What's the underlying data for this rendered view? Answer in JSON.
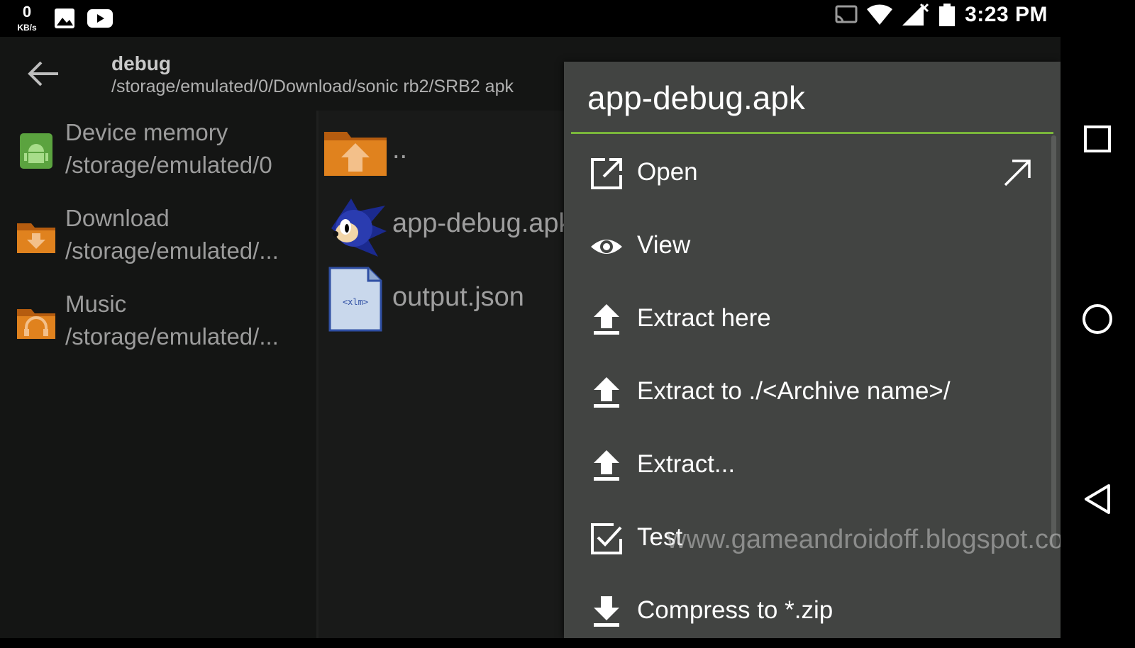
{
  "status_bar": {
    "speed_value": "0",
    "speed_unit": "KB/s",
    "time": "3:23 PM",
    "icons": [
      "network-speed-icon",
      "gallery-icon",
      "youtube-icon",
      "cast-icon",
      "wifi-icon",
      "signal-icon",
      "battery-icon"
    ]
  },
  "toolbar": {
    "title": "debug",
    "path": "/storage/emulated/0/Download/sonic rb2/SRB2 apk"
  },
  "sidebar": {
    "items": [
      {
        "name": "Device memory",
        "path": "/storage/emulated/0",
        "icon": "android-storage-icon"
      },
      {
        "name": "Download",
        "path": "/storage/emulated/...",
        "icon": "download-folder-icon"
      },
      {
        "name": "Music",
        "path": "/storage/emulated/...",
        "icon": "music-folder-icon"
      }
    ]
  },
  "files": [
    {
      "name": "..",
      "icon": "parent-folder-icon"
    },
    {
      "name": "app-debug.apk",
      "icon": "sonic-apk-icon"
    },
    {
      "name": "output.json",
      "icon": "xml-file-icon"
    }
  ],
  "context_menu": {
    "title": "app-debug.apk",
    "items": [
      {
        "label": "Open",
        "icon": "open-external-icon"
      },
      {
        "label": "View",
        "icon": "eye-icon"
      },
      {
        "label": "Extract here",
        "icon": "upload-icon"
      },
      {
        "label": "Extract to ./<Archive name>/",
        "icon": "upload-icon"
      },
      {
        "label": "Extract...",
        "icon": "upload-icon"
      },
      {
        "label": "Test",
        "icon": "checkbox-icon"
      },
      {
        "label": "Compress to *.zip",
        "icon": "download-icon"
      }
    ]
  },
  "watermark": "www.gameandroidoff.blogspot.com",
  "colors": {
    "accent": "#7ab73b",
    "menu_bg": "#424442",
    "folder_orange": "#e0821e"
  }
}
